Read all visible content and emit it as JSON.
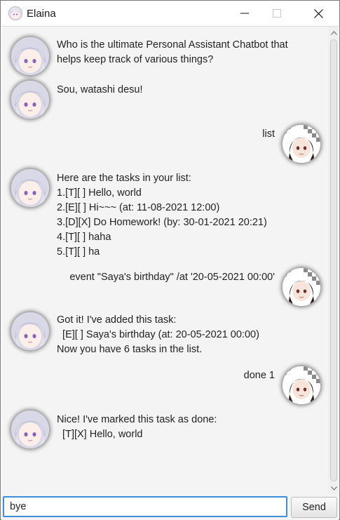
{
  "window": {
    "title": "Elaina"
  },
  "messages": [
    {
      "sender": "bot",
      "lines": [
        "Who is the ultimate Personal Assistant Chatbot that",
        "helps keep track of various things?"
      ]
    },
    {
      "sender": "bot",
      "lines": [
        "Sou, watashi desu!"
      ]
    },
    {
      "sender": "user",
      "lines": [
        "list"
      ]
    },
    {
      "sender": "bot",
      "lines": [
        "Here are the tasks in your list:",
        "1.[T][ ] Hello, world",
        "2.[E][ ] Hi~~~ (at: 11-08-2021 12:00)",
        "3.[D][X] Do Homework! (by: 30-01-2021 20:21)",
        "4.[T][ ] haha",
        "5.[T][ ] ha"
      ]
    },
    {
      "sender": "user",
      "lines": [
        "event \"Saya's birthday\" /at '20-05-2021 00:00'"
      ]
    },
    {
      "sender": "bot",
      "lines": [
        "Got it! I've added this task:",
        "  [E][ ] Saya's birthday (at: 20-05-2021 00:00)",
        "Now you have 6 tasks in the list."
      ]
    },
    {
      "sender": "user",
      "lines": [
        "done 1"
      ]
    },
    {
      "sender": "bot",
      "lines": [
        "Nice! I've marked this task as done:",
        "  [T][X] Hello, world"
      ]
    }
  ],
  "input": {
    "value": "bye",
    "send_label": "Send"
  },
  "icons": {
    "app": "anime-girl-app-icon",
    "minimize": "minimize-icon",
    "maximize": "maximize-icon",
    "close": "close-icon",
    "bot_avatar": "white-haired-girl-avatar",
    "user_avatar": "dark-haired-girl-avatar"
  },
  "colors": {
    "chat_background": "#f4f4f4",
    "input_focus_border": "#3d8fd6",
    "bot_hair": "#dfe3ee",
    "user_hair": "#2a1e1a"
  }
}
